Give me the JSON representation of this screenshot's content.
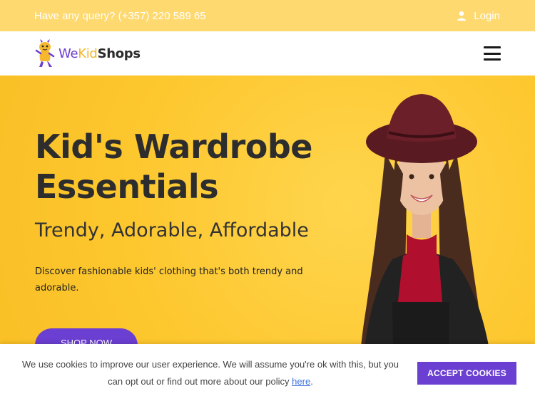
{
  "topbar": {
    "query_text": "Have any query? (+357) 220 589 65",
    "login_label": "Login",
    "login_icon": "user-icon"
  },
  "navbar": {
    "logo": {
      "part_we": "We",
      "part_kid": "Kid",
      "part_shops": "Shops"
    },
    "menu_icon": "hamburger-menu-icon"
  },
  "hero": {
    "title_line1": "Kid's Wardrobe",
    "title_line2": "Essentials",
    "subtitle": "Trendy, Adorable, Affordable",
    "description": "Discover fashionable kids' clothing that's both trendy and adorable.",
    "cta_label": "SHOP NOW"
  },
  "cookie": {
    "message": "We use cookies to improve our user experience. We will assume you're ok with this, but you can opt out or find out more about our policy ",
    "link_label": "here",
    "trailing": ".",
    "accept_label": "ACCEPT COOKIES"
  },
  "colors": {
    "topbar_bg": "#fed96f",
    "hero_bg": "#fdc72e",
    "accent_purple": "#6b3fd1",
    "link_blue": "#3b6fe0"
  }
}
